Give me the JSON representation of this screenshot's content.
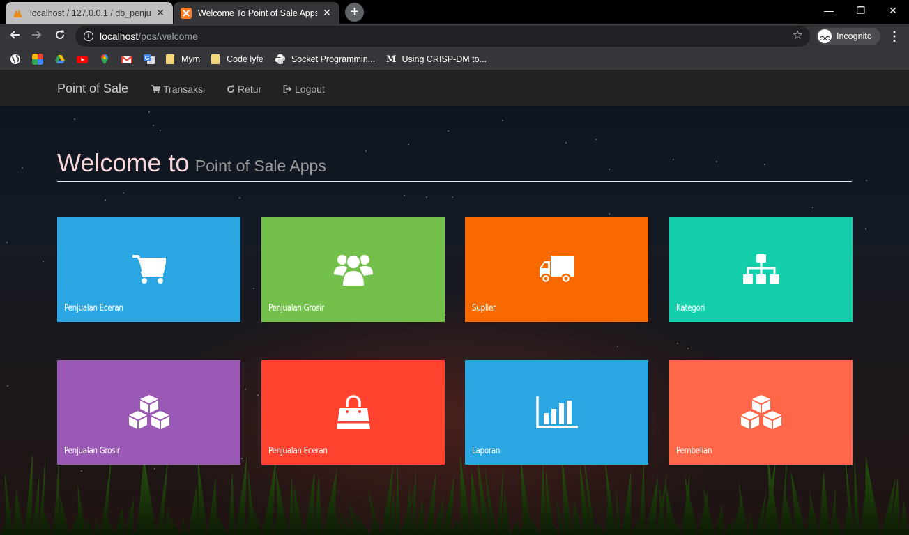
{
  "browser": {
    "tabs": [
      {
        "title": "localhost / 127.0.0.1 / db_penjual",
        "active": false
      },
      {
        "title": "Welcome To Point of Sale Apps",
        "active": true
      }
    ],
    "url_host": "localhost",
    "url_path": "/pos/welcome",
    "profile_label": "Incognito",
    "bookmarks": [
      {
        "label": "",
        "icon": "globe-icon"
      },
      {
        "label": "",
        "icon": "photos-icon"
      },
      {
        "label": "",
        "icon": "drive-icon"
      },
      {
        "label": "",
        "icon": "youtube-icon"
      },
      {
        "label": "",
        "icon": "maps-icon"
      },
      {
        "label": "",
        "icon": "gmail-icon"
      },
      {
        "label": "",
        "icon": "translate-icon"
      },
      {
        "label": "Mym",
        "icon": "folder-icon"
      },
      {
        "label": "Code lyfe",
        "icon": "folder-icon"
      },
      {
        "label": "Socket Programmin...",
        "icon": "python-icon"
      },
      {
        "label": "Using CRISP-DM to...",
        "icon": "medium-icon"
      }
    ]
  },
  "navbar": {
    "brand": "Point of Sale",
    "items": [
      {
        "label": "Transaksi",
        "icon": "cart-icon"
      },
      {
        "label": "Retur",
        "icon": "refresh-icon"
      },
      {
        "label": "Logout",
        "icon": "logout-icon"
      }
    ]
  },
  "heading": {
    "main": "Welcome to",
    "sub": "Point of Sale Apps"
  },
  "tiles": [
    {
      "label": "Penjualan Eceran",
      "icon": "shopping-cart-icon",
      "color": "#2aa7e2"
    },
    {
      "label": "Penjualan Grosir",
      "icon": "users-icon",
      "color": "#73c14a"
    },
    {
      "label": "Suplier",
      "icon": "truck-icon",
      "color": "#f86a00"
    },
    {
      "label": "Kategori",
      "icon": "sitemap-icon",
      "color": "#13cfac"
    },
    {
      "label": "Penjualan Grosir",
      "icon": "cubes-icon",
      "color": "#9b59b6"
    },
    {
      "label": "Penjualan Eceran",
      "icon": "shopping-bag-icon",
      "color": "#ff432e"
    },
    {
      "label": "Laporan",
      "icon": "bar-chart-icon",
      "color": "#2aa7e2"
    },
    {
      "label": "Pembelian",
      "icon": "cubes-icon",
      "color": "#ff6748"
    }
  ]
}
